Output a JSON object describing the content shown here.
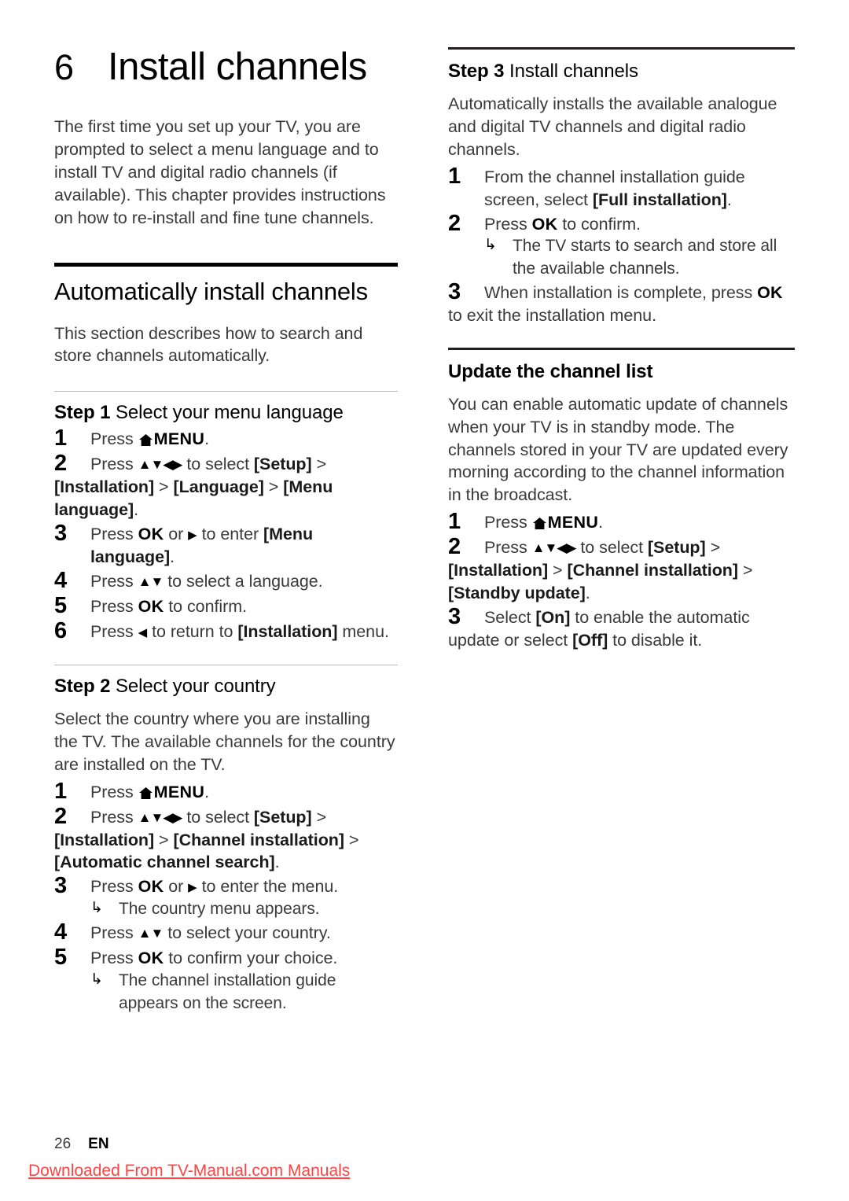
{
  "chapter": {
    "number": "6",
    "title": "Install channels",
    "intro": "The first time you set up your TV, you are prompted to select a menu language and to install TV and digital radio channels (if available). This chapter provides instructions on how to re-install and fine tune channels."
  },
  "icons": {
    "home": "home-icon",
    "arrows_all": "▲▼◀▶",
    "arrow_right": "▶",
    "arrow_left": "◀",
    "arrow_updown": "▲▼",
    "result_arrow": "↳"
  },
  "sections": {
    "auto_install": {
      "heading": "Automatically install channels",
      "intro": "This section describes how to search and store channels automatically."
    },
    "step1": {
      "label": "Step 1",
      "title": "Select your menu language",
      "steps": [
        {
          "num": "1",
          "parts": [
            {
              "t": "Press ",
              "w": "n"
            },
            {
              "t": "HOMEICON",
              "w": "icon"
            },
            {
              "t": "MENU",
              "w": "b"
            },
            {
              "t": ".",
              "w": "n"
            }
          ]
        },
        {
          "num": "2",
          "parts": [
            {
              "t": "Press ",
              "w": "n"
            },
            {
              "t": "▲▼◀▶",
              "w": "arrows"
            },
            {
              "t": " to select ",
              "w": "n"
            },
            {
              "t": "[Setup]",
              "w": "b"
            },
            {
              "t": " > ",
              "w": "n"
            },
            {
              "t": "[Installation]",
              "w": "b"
            },
            {
              "t": " > ",
              "w": "n"
            },
            {
              "t": "[Language]",
              "w": "b"
            },
            {
              "t": " > ",
              "w": "n"
            },
            {
              "t": "[Menu language]",
              "w": "b"
            },
            {
              "t": ".",
              "w": "n"
            }
          ]
        },
        {
          "num": "3",
          "parts": [
            {
              "t": "Press ",
              "w": "n"
            },
            {
              "t": "OK",
              "w": "ok"
            },
            {
              "t": " or ",
              "w": "n"
            },
            {
              "t": "▶",
              "w": "arrow1"
            },
            {
              "t": " to enter ",
              "w": "n"
            },
            {
              "t": "[Menu language]",
              "w": "b"
            },
            {
              "t": ".",
              "w": "n"
            }
          ]
        },
        {
          "num": "4",
          "parts": [
            {
              "t": "Press ",
              "w": "n"
            },
            {
              "t": "▲▼",
              "w": "arrows"
            },
            {
              "t": " to select a language.",
              "w": "n"
            }
          ]
        },
        {
          "num": "5",
          "parts": [
            {
              "t": "Press ",
              "w": "n"
            },
            {
              "t": "OK",
              "w": "ok"
            },
            {
              "t": " to confirm.",
              "w": "n"
            }
          ]
        },
        {
          "num": "6",
          "parts": [
            {
              "t": "Press ",
              "w": "n"
            },
            {
              "t": "◀",
              "w": "arrow1"
            },
            {
              "t": " to return to ",
              "w": "n"
            },
            {
              "t": "[Installation]",
              "w": "b"
            },
            {
              "t": " menu.",
              "w": "n"
            }
          ]
        }
      ]
    },
    "step2": {
      "label": "Step 2",
      "title": "Select your country",
      "intro": "Select the country where you are installing the TV. The available channels for the country are installed on the TV.",
      "results": {
        "country_menu": "The country menu appears.",
        "guide_appears": "The channel installation guide appears on the screen."
      }
    },
    "step3": {
      "label": "Step 3",
      "title": "Install channels",
      "intro": "Automatically installs the available analogue and digital TV channels and digital radio channels.",
      "results": {
        "search_store": "The TV starts to search and store all the available channels."
      }
    },
    "update_list": {
      "heading": "Update the channel list",
      "intro": "You can enable automatic update of channels when your TV is in standby mode. The channels stored in your TV are updated every morning according to the channel information in the broadcast."
    }
  },
  "footer": {
    "page_number": "26",
    "language_code": "EN",
    "watermark": "Downloaded From TV-Manual.com Manuals",
    "watermark_color": "#ff4444"
  }
}
